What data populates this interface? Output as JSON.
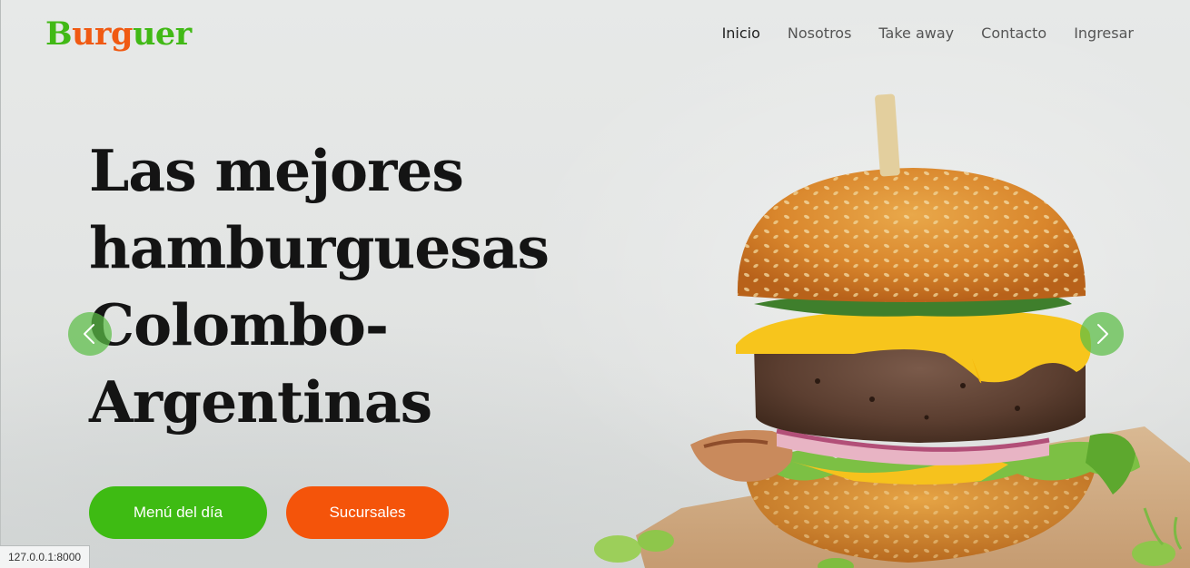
{
  "brand": {
    "logo_part1": "B",
    "logo_part2": "u",
    "logo_part3": "rg",
    "logo_part4": "u",
    "logo_part5": "er",
    "colors": {
      "green": "#41b916",
      "orange": "#f05a13"
    }
  },
  "nav": {
    "items": [
      {
        "label": "Inicio",
        "active": true
      },
      {
        "label": "Nosotros",
        "active": false
      },
      {
        "label": "Take away",
        "active": false
      },
      {
        "label": "Contacto",
        "active": false
      },
      {
        "label": "Ingresar",
        "active": false
      }
    ]
  },
  "hero": {
    "headline_lines": [
      "Las mejores",
      "hamburguesas",
      "Colombo-",
      "Argentinas"
    ],
    "buttons": {
      "menu_label": "Menú del día",
      "sucursales_label": "Sucursales"
    },
    "carousel": {
      "prev_icon": "chevron-left-icon",
      "next_icon": "chevron-right-icon"
    },
    "colors": {
      "menu_button": "#3ebb13",
      "sucursales_button": "#f4540a",
      "headline": "#141414"
    }
  },
  "status_bar": {
    "url": "127.0.0.1:8000"
  }
}
